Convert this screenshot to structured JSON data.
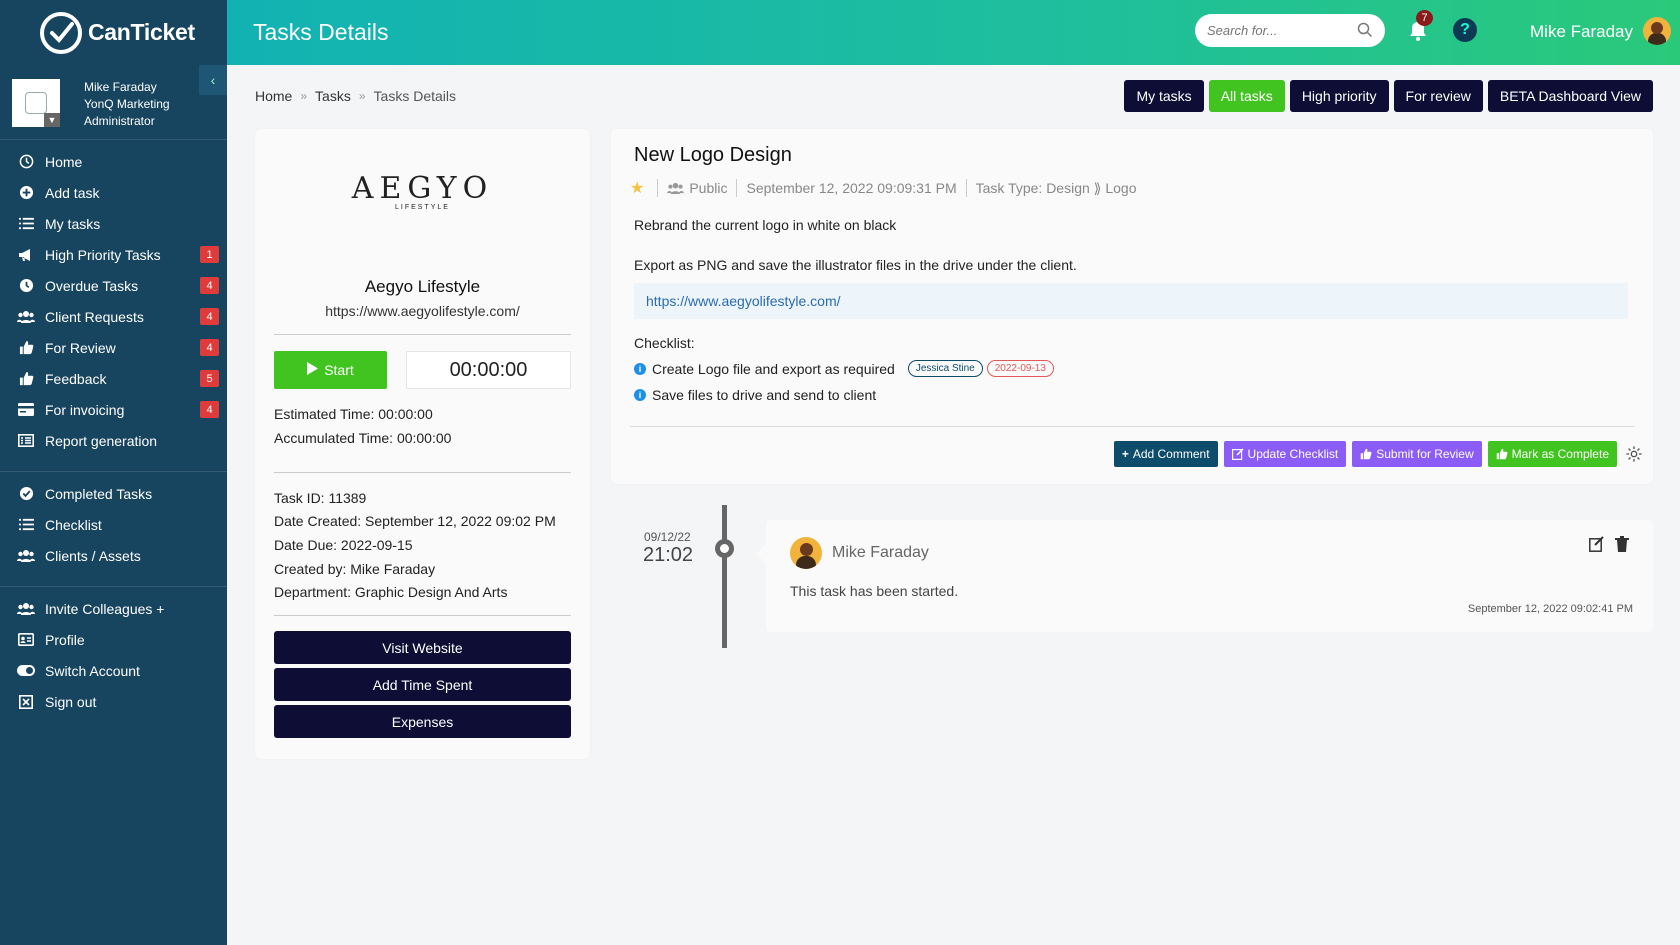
{
  "sidebar": {
    "logo_text": "CanTicket",
    "profile": {
      "name": "Mike Faraday",
      "company": "YonQ Marketing",
      "role": "Administrator"
    },
    "items": [
      {
        "label": "Home",
        "icon": "clock-icon"
      },
      {
        "label": "Add task",
        "icon": "plus-circle-icon"
      },
      {
        "label": "My tasks",
        "icon": "list-icon"
      },
      {
        "label": "High Priority Tasks",
        "icon": "megaphone-icon",
        "badge": "1"
      },
      {
        "label": "Overdue Tasks",
        "icon": "clock-icon",
        "badge": "4"
      },
      {
        "label": "Client Requests",
        "icon": "users-icon",
        "badge": "4"
      },
      {
        "label": "For Review",
        "icon": "thumbs-up-icon",
        "badge": "4"
      },
      {
        "label": "Feedback",
        "icon": "thumbs-up-icon",
        "badge": "5"
      },
      {
        "label": "For invoicing",
        "icon": "credit-card-icon",
        "badge": "4"
      },
      {
        "label": "Report generation",
        "icon": "report-icon"
      },
      {
        "label": "Completed Tasks",
        "icon": "check-circle-icon"
      },
      {
        "label": "Checklist",
        "icon": "list-icon"
      },
      {
        "label": "Clients / Assets",
        "icon": "users-icon"
      },
      {
        "label": "Invite Colleagues +",
        "icon": "users-icon"
      },
      {
        "label": "Profile",
        "icon": "id-card-icon"
      },
      {
        "label": "Switch Account",
        "icon": "toggle-icon"
      },
      {
        "label": "Sign out",
        "icon": "close-box-icon"
      }
    ]
  },
  "header": {
    "title": "Tasks Details",
    "search_placeholder": "Search for...",
    "notification_count": "7",
    "user_name": "Mike Faraday"
  },
  "breadcrumb": {
    "home": "Home",
    "tasks": "Tasks",
    "current": "Tasks Details"
  },
  "filters": [
    {
      "label": "My tasks",
      "active": false
    },
    {
      "label": "All tasks",
      "active": true
    },
    {
      "label": "High priority",
      "active": false
    },
    {
      "label": "For review",
      "active": false
    },
    {
      "label": "BETA Dashboard View",
      "active": false
    }
  ],
  "client": {
    "logo_text": "AEGYO",
    "logo_sub": "LIFESTYLE",
    "name": "Aegyo Lifestyle",
    "url": "https://www.aegyolifestyle.com/",
    "start_label": "Start",
    "timer": "00:00:00",
    "estimated_time": "Estimated Time: 00:00:00",
    "accumulated_time": "Accumulated Time: 00:00:00",
    "task_id": "Task ID: 11389",
    "date_created": "Date Created: September 12, 2022 09:02 PM",
    "date_due": "Date Due: 2022-09-15",
    "created_by": "Created by: Mike Faraday",
    "department": "Department: Graphic Design And Arts",
    "visit_website": "Visit Website",
    "add_time_spent": "Add Time Spent",
    "expenses": "Expenses"
  },
  "task": {
    "title": "New Logo Design",
    "visibility": "Public",
    "timestamp": "September 12, 2022 09:09:31 PM",
    "task_type": "Task Type: Design ⟫ Logo",
    "description_1": "Rebrand the current logo in white on black",
    "description_2": "Export as PNG and save the illustrator files in the drive under the client.",
    "link": "https://www.aegyolifestyle.com/",
    "checklist_label": "Checklist:",
    "checklist": [
      {
        "text": "Create Logo file and export as required",
        "assignee": "Jessica Stine",
        "due": "2022-09-13"
      },
      {
        "text": "Save files to drive and send to client"
      }
    ],
    "actions": {
      "add_comment": "Add Comment",
      "update_checklist": "Update Checklist",
      "submit_review": "Submit for Review",
      "mark_complete": "Mark as Complete"
    }
  },
  "timeline": {
    "date": "09/12/22",
    "time": "21:02",
    "entry": {
      "author": "Mike Faraday",
      "text": "This task has been started.",
      "timestamp": "September 12, 2022 09:02:41 PM"
    }
  },
  "colors": {
    "sidebar_bg": "#17445e",
    "header_gradient_start": "#12b2b3",
    "header_gradient_end": "#2ac97a",
    "accent_green": "#41c41f",
    "dark_navy": "#0d0d35",
    "purple": "#8b5cf6",
    "badge_red": "#e03b3b"
  }
}
